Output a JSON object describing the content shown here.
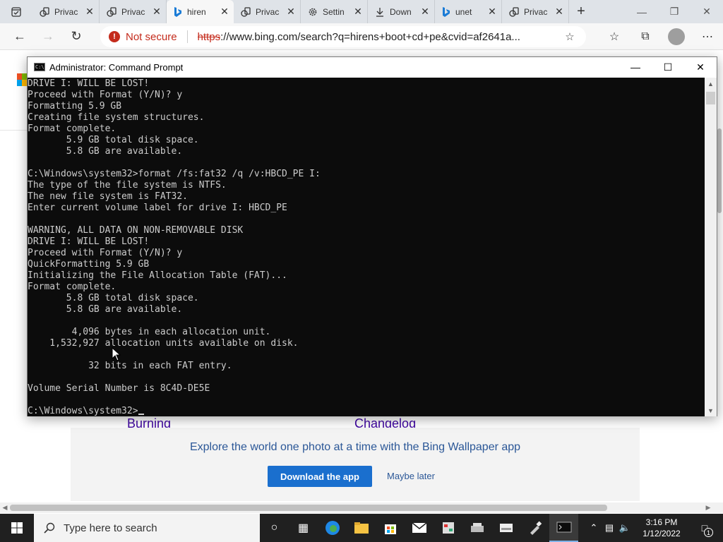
{
  "browser": {
    "tabs": [
      {
        "title": "Privac",
        "icon": "page-icon"
      },
      {
        "title": "Privac",
        "icon": "page-icon"
      },
      {
        "title": "hiren",
        "icon": "bing-icon"
      },
      {
        "title": "Privac",
        "icon": "page-icon"
      },
      {
        "title": "Settin",
        "icon": "gear-icon"
      },
      {
        "title": "Down",
        "icon": "download-icon"
      },
      {
        "title": "unet",
        "icon": "bing-icon"
      },
      {
        "title": "Privac",
        "icon": "page-icon"
      }
    ],
    "active_tab_index": 2,
    "security_label": "Not secure",
    "url_scheme": "https",
    "url_rest": "://www.bing.com/search?q=hirens+boot+cd+pe&cvid=af2641a..."
  },
  "page": {
    "links": [
      "Burning",
      "Changelog"
    ],
    "promo_text": "Explore the world one photo at a time with the Bing Wallpaper app",
    "download_label": "Download the app",
    "later_label": "Maybe later"
  },
  "cmd": {
    "title": "Administrator: Command Prompt",
    "lines": [
      "DRIVE I: WILL BE LOST!",
      "Proceed with Format (Y/N)? y",
      "Formatting 5.9 GB",
      "Creating file system structures.",
      "Format complete.",
      "       5.9 GB total disk space.",
      "       5.8 GB are available.",
      "",
      "C:\\Windows\\system32>format /fs:fat32 /q /v:HBCD_PE I:",
      "The type of the file system is NTFS.",
      "The new file system is FAT32.",
      "Enter current volume label for drive I: HBCD_PE",
      "",
      "WARNING, ALL DATA ON NON-REMOVABLE DISK",
      "DRIVE I: WILL BE LOST!",
      "Proceed with Format (Y/N)? y",
      "QuickFormatting 5.9 GB",
      "Initializing the File Allocation Table (FAT)...",
      "Format complete.",
      "       5.8 GB total disk space.",
      "       5.8 GB are available.",
      "",
      "        4,096 bytes in each allocation unit.",
      "    1,532,927 allocation units available on disk.",
      "",
      "           32 bits in each FAT entry.",
      "",
      "Volume Serial Number is 8C4D-DE5E",
      ""
    ],
    "prompt": "C:\\Windows\\system32>"
  },
  "taskbar": {
    "search_placeholder": "Type here to search",
    "time": "3:16 PM",
    "date": "1/12/2022",
    "notification_count": "1"
  }
}
